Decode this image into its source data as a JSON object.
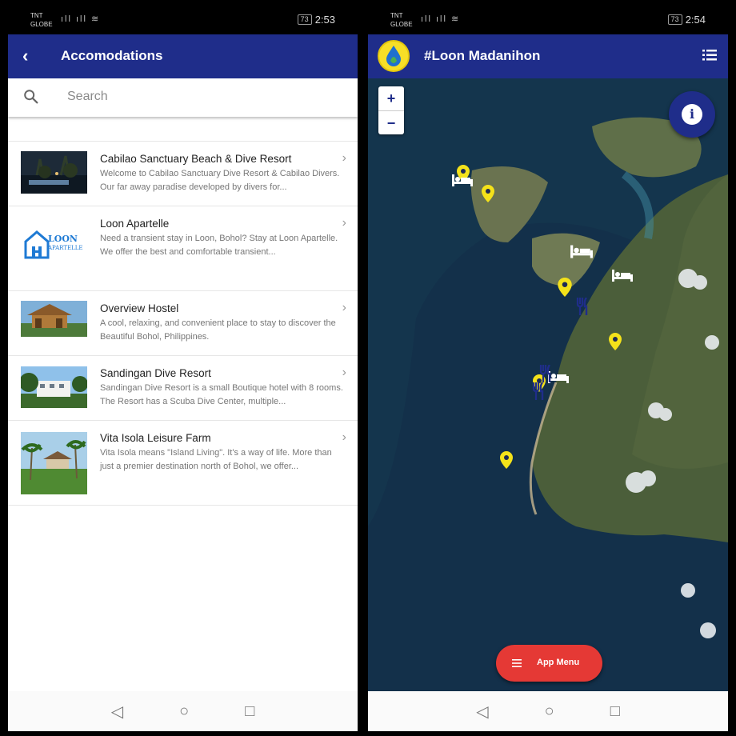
{
  "left_phone": {
    "status": {
      "carrier_line1": "TNT",
      "carrier_line2": "GLOBE",
      "signal": "ıll ıll ≋",
      "battery": "73",
      "time": "2:53"
    },
    "appbar": {
      "title": "Accomodations",
      "back_icon": "chevron-left-icon"
    },
    "search": {
      "placeholder": "Search",
      "value": ""
    },
    "items": [
      {
        "title": "Cabilao Sanctuary Beach & Dive Resort",
        "desc": "Welcome to Cabilao Sanctuary Dive Resort & Cabilao Divers. Our far away paradise developed by divers for..."
      },
      {
        "title": "Loon Apartelle",
        "desc": "Need a transient stay in Loon, Bohol? Stay at Loon Apartelle. We offer the best and comfortable transient...",
        "logo_text_1": "LOON",
        "logo_text_2": "APARTELLE"
      },
      {
        "title": "Overview Hostel",
        "desc": "A cool, relaxing, and convenient place to stay to discover the Beautiful Bohol, Philippines."
      },
      {
        "title": "Sandingan Dive Resort",
        "desc": "Sandingan Dive Resort is a small Boutique hotel with 8 rooms. The Resort has a Scuba Dive Center, multiple..."
      },
      {
        "title": "Vita Isola Leisure Farm",
        "desc": "Vita Isola means \"Island Living\". It's a way of life. More than just a premier destination north of Bohol, we offer..."
      }
    ],
    "chevron": "›",
    "nav": {
      "back": "◁",
      "home": "○",
      "recents": "□"
    }
  },
  "right_phone": {
    "status": {
      "carrier_line1": "TNT",
      "carrier_line2": "GLOBE",
      "signal": "ıll ıll ≋",
      "battery": "73",
      "time": "2:54"
    },
    "appbar": {
      "title": "#Loon Madanihon",
      "menu_icon": "list-icon"
    },
    "map": {
      "zoom_in": "+",
      "zoom_out": "−",
      "info": "i",
      "colors": {
        "water": "#14314a",
        "land": "#4a5e3a",
        "pin": "#f4e21a",
        "restaurant": "#1f2d8a"
      }
    },
    "fab": {
      "label": "App Menu"
    },
    "nav": {
      "back": "◁",
      "home": "○",
      "recents": "□"
    }
  }
}
